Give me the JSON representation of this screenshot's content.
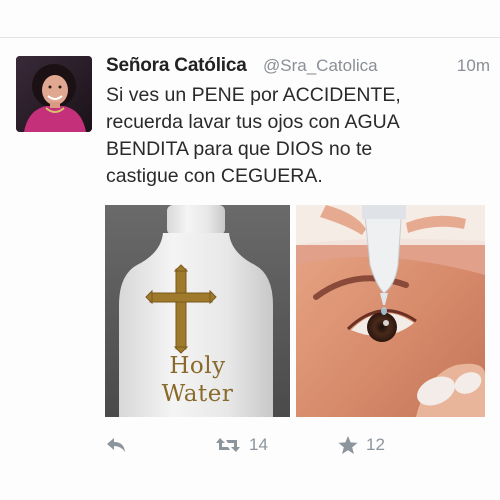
{
  "tweet": {
    "author": {
      "display_name": "Señora Católica",
      "handle": "@Sra_Catolica"
    },
    "time": "10m",
    "text_lines": [
      "Si ves un PENE por ACCIDENTE,",
      "recuerda lavar tus ojos con AGUA",
      "BENDITA para que DIOS no te",
      "castigue con CEGUERA."
    ],
    "media": {
      "left_image": {
        "label_lines": [
          "Holy",
          "Water"
        ]
      },
      "right_image": {}
    },
    "actions": {
      "reply_icon": "reply-arrow-icon",
      "retweet_icon": "retweet-icon",
      "retweet_count": "14",
      "favorite_icon": "star-icon",
      "favorite_count": "12"
    }
  },
  "colors": {
    "text": "#2a2a2a",
    "muted": "#8a8f95",
    "action_gray": "#8c949c",
    "gold": "#a07a2c"
  }
}
